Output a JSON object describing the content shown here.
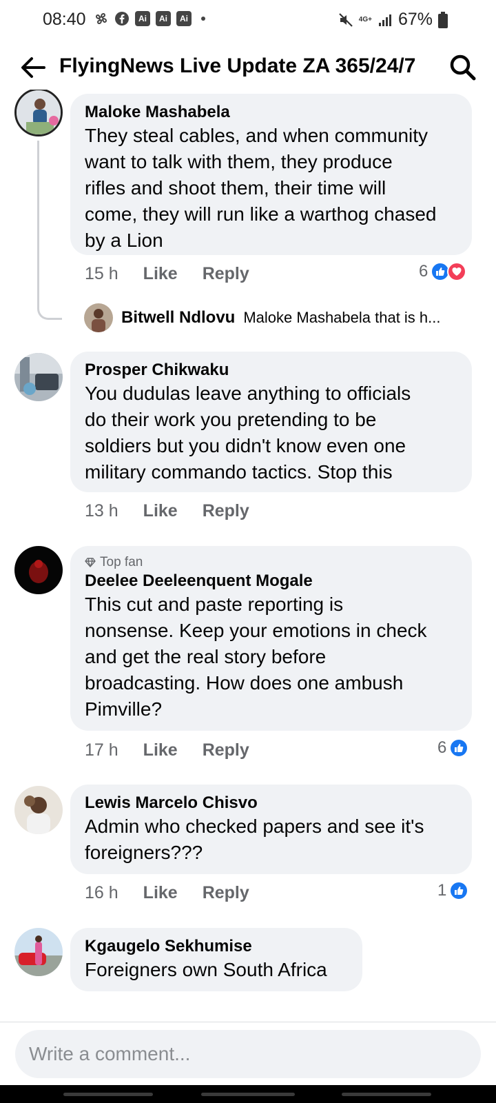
{
  "status_bar": {
    "time": "08:40",
    "ai_badges": [
      "Ai",
      "Ai",
      "Ai"
    ],
    "network": "4G+",
    "battery": "67%",
    "left_icons": [
      "pinwheel-icon",
      "facebook-icon"
    ],
    "right_icons": [
      "mute-icon",
      "signal-icon",
      "battery-icon"
    ]
  },
  "header": {
    "title": "FlyingNews Live Update ZA 365/24/7"
  },
  "comments": [
    {
      "name": "Maloke Mashabela",
      "text": "They steal cables, and when community want to talk with them, they produce rifles and shoot them, their time will come, they will run like a warthog chased by a Lion",
      "lines": [
        "They steal cables, and when community",
        "want to talk with them, they produce",
        "rifles and shoot them, their time will",
        "come, they will run like a warthog chased",
        "by a Lion"
      ],
      "time": "15 h",
      "like": "Like",
      "reply": "Reply",
      "reaction_count": "6",
      "reactions": [
        "like",
        "love"
      ],
      "reply_preview": {
        "name": "Bitwell Ndlovu",
        "text": "Maloke Mashabela that is h..."
      }
    },
    {
      "name": "Prosper Chikwaku",
      "lines": [
        "You dudulas leave anything to officials",
        "do their work you pretending to be",
        "soldiers but you didn't know even one",
        "military commando tactics. Stop this"
      ],
      "time": "13 h",
      "like": "Like",
      "reply": "Reply"
    },
    {
      "badge": "Top fan",
      "name": "Deelee Deeleenquent Mogale",
      "lines": [
        "This cut and paste reporting is",
        "nonsense. Keep your emotions in check",
        "and get the real story before",
        "broadcasting. How does one ambush",
        "Pimville?"
      ],
      "time": "17 h",
      "like": "Like",
      "reply": "Reply",
      "reaction_count": "6",
      "reactions": [
        "like"
      ]
    },
    {
      "name": "Lewis Marcelo Chisvo",
      "lines": [
        "Admin who checked papers and see it's",
        "foreigners???"
      ],
      "time": "16 h",
      "like": "Like",
      "reply": "Reply",
      "reaction_count": "1",
      "reactions": [
        "like"
      ]
    },
    {
      "name": "Kgaugelo Sekhumise",
      "lines": [
        "Foreigners own South Africa"
      ]
    }
  ],
  "composer": {
    "placeholder": "Write a comment..."
  },
  "colors": {
    "bubble": "#f0f2f5",
    "secondary_text": "#65676b",
    "like_blue": "#1877f2",
    "love_red": "#f33e58"
  }
}
